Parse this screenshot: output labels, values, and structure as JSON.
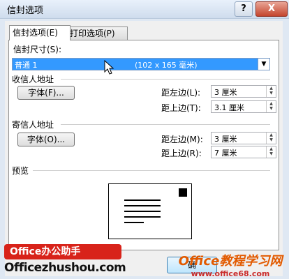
{
  "window": {
    "title": "信封选项",
    "help": "?",
    "close": "X"
  },
  "tabs": [
    {
      "label": "信封选项(E)"
    },
    {
      "label": "打印选项(P)"
    }
  ],
  "envelope_size": {
    "label": "信封尺寸(S):",
    "value_name": "普通 1",
    "value_dims": "(102 x 165 毫米)"
  },
  "recipient": {
    "heading": "收信人地址",
    "font_button": "字体(F)...",
    "left_label": "距左边(L):",
    "left_value": "3 厘米",
    "top_label": "距上边(T):",
    "top_value": "3.1 厘米"
  },
  "sender": {
    "heading": "寄信人地址",
    "font_button": "字体(O)...",
    "left_label": "距左边(M):",
    "left_value": "3 厘米",
    "top_label": "距上边(R):",
    "top_value": "7 厘米"
  },
  "preview": {
    "heading": "预览"
  },
  "ok_button": "确",
  "overlay": {
    "banner_title": "Office办公助手",
    "banner_url": "Officezhushou.com",
    "watermark_title": "Office教程学习网",
    "watermark_url": "www.office68.com"
  }
}
